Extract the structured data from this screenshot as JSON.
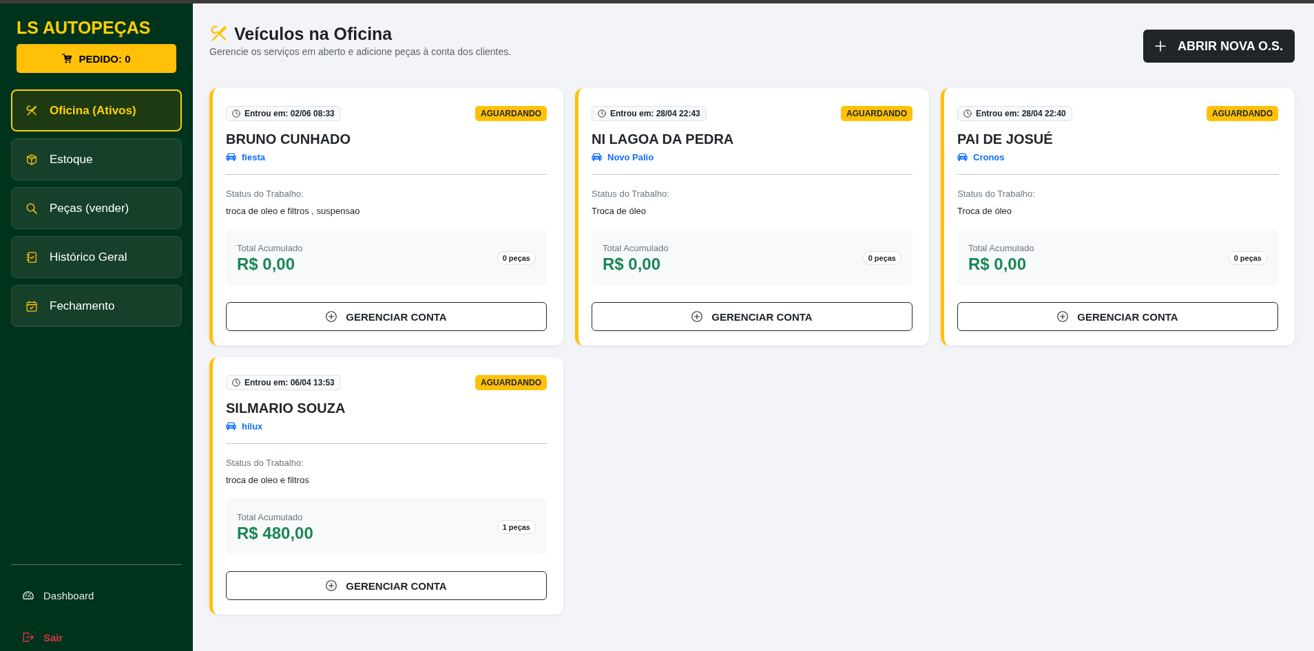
{
  "sidebar": {
    "brand": "LS AUTOPEÇAS",
    "order_button": "PEDIDO: 0",
    "nav": [
      {
        "label": "Oficina (Ativos)",
        "selected": true
      },
      {
        "label": "Estoque",
        "selected": false
      },
      {
        "label": "Peças (vender)",
        "selected": false
      },
      {
        "label": "Histórico Geral",
        "selected": false
      },
      {
        "label": "Fechamento",
        "selected": false
      }
    ],
    "footer_links": [
      {
        "label": "Dashboard",
        "kind": "normal"
      },
      {
        "label": "Sair",
        "kind": "danger"
      }
    ]
  },
  "header": {
    "title": "Veículos na Oficina",
    "subtitle": "Gerencie os serviços em aberto e adicione peças à conta dos clientes.",
    "new_order_button": "ABRIR NOVA O.S."
  },
  "vehicles": [
    {
      "entered": "Entrou em: 02/06 08:33",
      "status": "AGUARDANDO",
      "customer": "BRUNO CUNHADO",
      "vehicle": "fiesta",
      "work_label": "Status do Trabalho:",
      "work": "troca de oleo e filtros , suspensao",
      "total_label": "Total Acumulado",
      "total": "R$ 0,00",
      "parts": "0 peças",
      "action": "GERENCIAR CONTA"
    },
    {
      "entered": "Entrou em: 28/04 22:43",
      "status": "AGUARDANDO",
      "customer": "NI LAGOA DA PEDRA",
      "vehicle": "Novo Palio",
      "work_label": "Status do Trabalho:",
      "work": "Troca de óleo",
      "total_label": "Total Acumulado",
      "total": "R$ 0,00",
      "parts": "0 peças",
      "action": "GERENCIAR CONTA"
    },
    {
      "entered": "Entrou em: 28/04 22:40",
      "status": "AGUARDANDO",
      "customer": "PAI DE JOSUÉ",
      "vehicle": "Cronos",
      "work_label": "Status do Trabalho:",
      "work": "Troca de óleo",
      "total_label": "Total Acumulado",
      "total": "R$ 0,00",
      "parts": "0 peças",
      "action": "GERENCIAR CONTA"
    },
    {
      "entered": "Entrou em: 06/04 13:53",
      "status": "AGUARDANDO",
      "customer": "SILMARIO SOUZA",
      "vehicle": "hilux",
      "work_label": "Status do Trabalho:",
      "work": "troca de oleo e filtros",
      "total_label": "Total Acumulado",
      "total": "R$ 480,00",
      "parts": "1 peças",
      "action": "GERENCIAR CONTA"
    }
  ]
}
